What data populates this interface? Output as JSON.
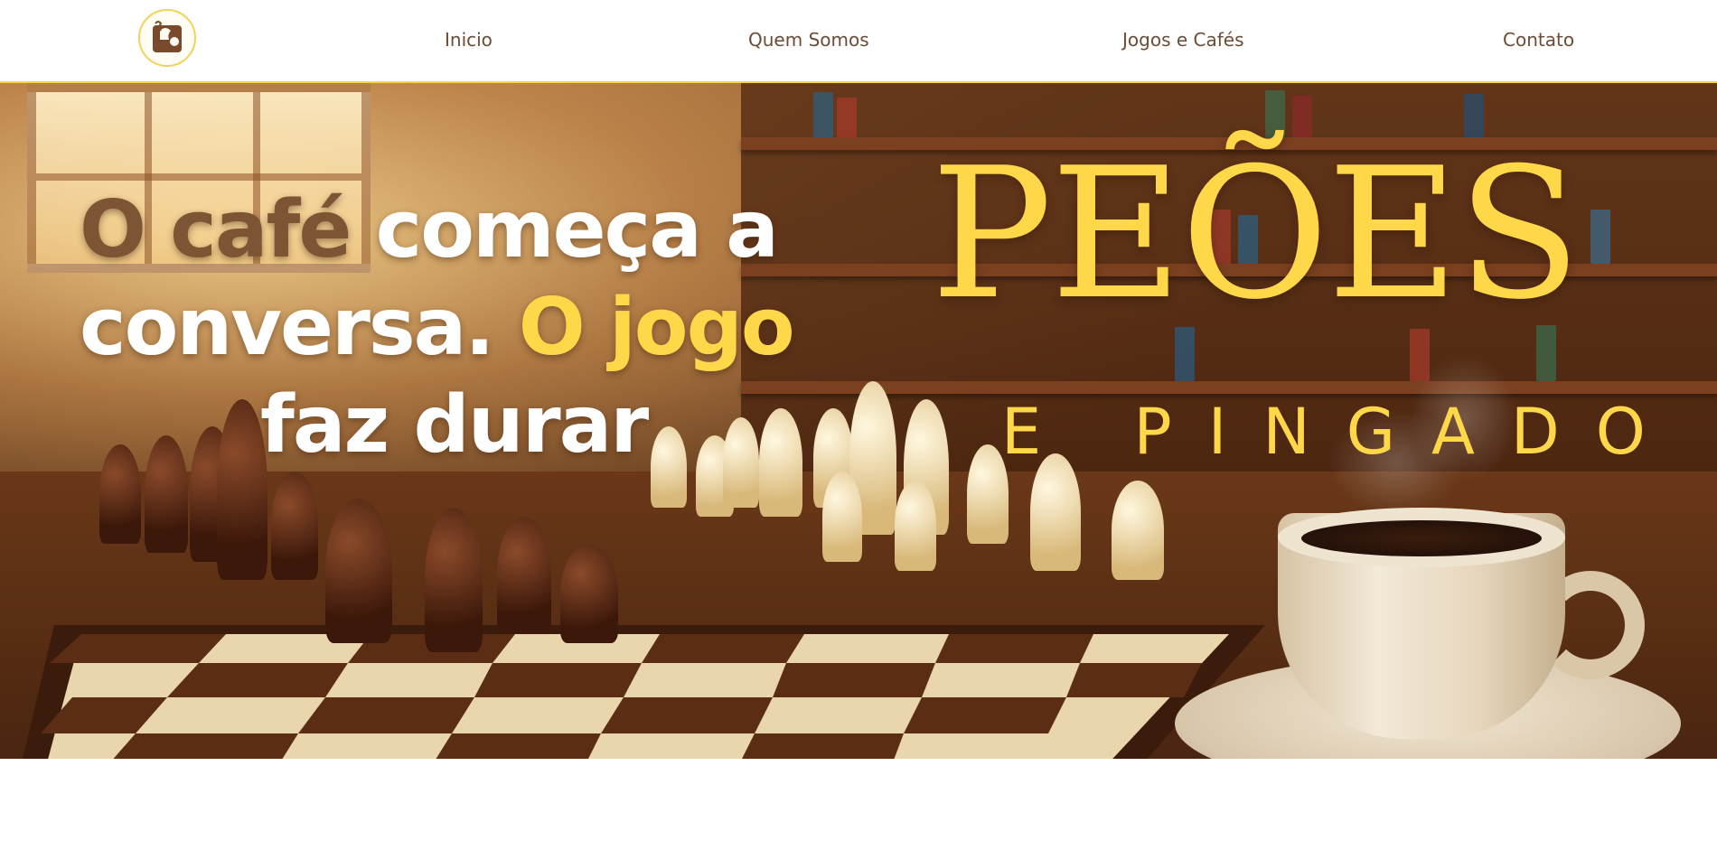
{
  "header": {
    "logo_icon": "coffee-chess-logo-icon",
    "nav": [
      {
        "label": "Inicio"
      },
      {
        "label": "Quem Somos"
      },
      {
        "label": "Jogos e Cafés"
      },
      {
        "label": "Contato"
      }
    ],
    "colors": {
      "nav_text": "#6d4c36",
      "accent_border": "#f3d24d"
    }
  },
  "hero": {
    "headline": {
      "part1": "O café",
      "part2": " começa a",
      "part3": "conversa. ",
      "part4": "O jogo",
      "part5": "faz durar"
    },
    "brand_title": "PEÕES",
    "brand_subtitle": "E PINGADO",
    "background_image": "chess-board-and-coffee-cup-cafe-scene",
    "colors": {
      "brown": "#7d5535",
      "white": "#ffffff",
      "yellow": "#ffd84a"
    }
  }
}
